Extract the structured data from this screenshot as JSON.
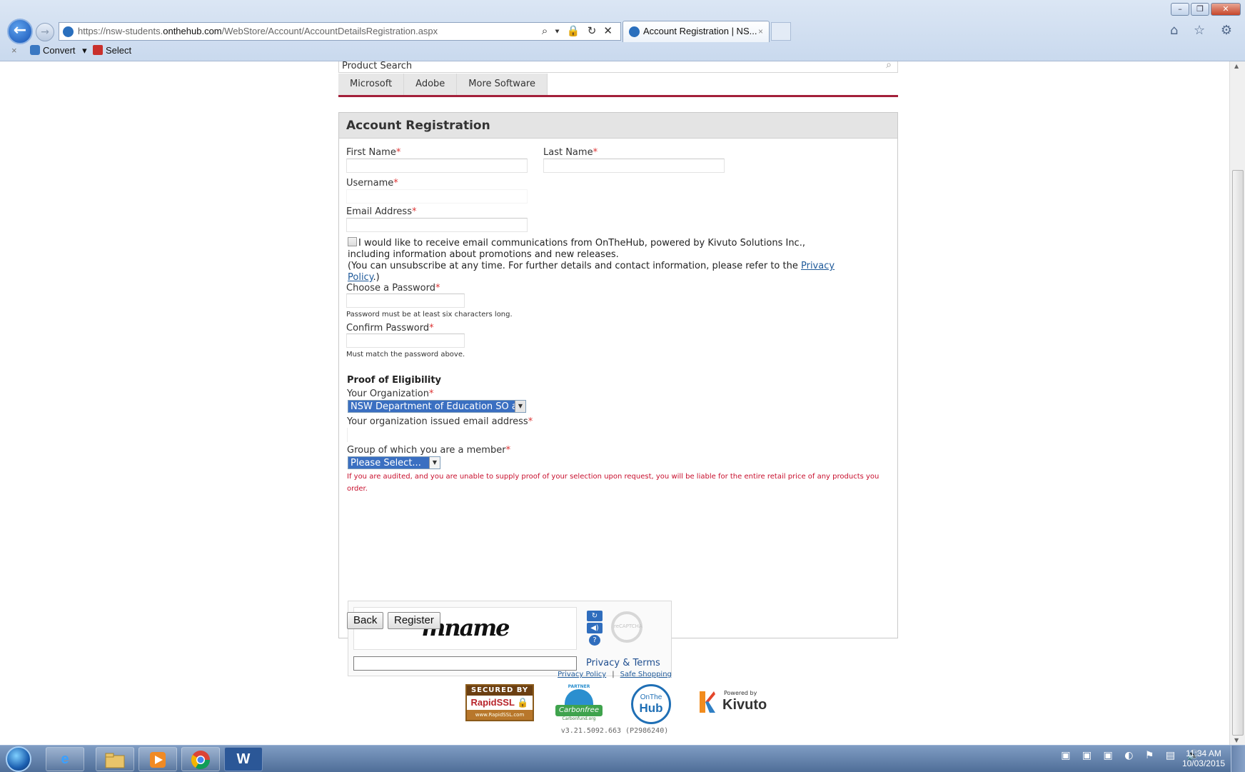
{
  "browser": {
    "url_prefix": "https://nsw-students.",
    "url_host": "onthehub.com",
    "url_path": "/WebStore/Account/AccountDetailsRegistration.aspx",
    "address_tools": "⌕ ▾ 🔒 ↻ ✕",
    "tab_title": "Account Registration | NS...",
    "tab_close": "×",
    "win_minimize": "–",
    "win_restore": "❐",
    "win_close": "✕",
    "right_icons": "⌂ ☆ ⚙",
    "cmd_close": "×",
    "cmd_convert": "Convert",
    "cmd_convert_arrow": "▾",
    "cmd_select": "Select"
  },
  "site": {
    "search_placeholder": "Product Search",
    "search_icon": "⌕",
    "menu": [
      "Microsoft",
      "Adobe",
      "More Software"
    ]
  },
  "form": {
    "title": "Account Registration",
    "required_marker": "*",
    "first_name_label": "First Name",
    "last_name_label": "Last Name",
    "username_label": "Username",
    "email_label": "Email Address",
    "consent_line1": "I would like to receive email communications from OnTheHub, powered by Kivuto Solutions Inc.,",
    "consent_line2": "including information about promotions and new releases.",
    "consent_line3_pre": "(You can unsubscribe at any time. For further details and contact information, please refer to the ",
    "consent_link_part1": "Privacy",
    "consent_link_part2": "Policy",
    "consent_line3_post": ".)",
    "password_label": "Choose a Password",
    "password_hint": "Password must be at least six characters long.",
    "confirm_label": "Confirm Password",
    "confirm_hint": "Must match the password above.",
    "eligibility_heading": "Proof of Eligibility",
    "organization_label": "Your Organization",
    "organization_value": "NSW Department of Education SO a",
    "org_email_label": "Your organization issued email address",
    "group_label": "Group of which you are a member",
    "group_value": "Please Select...",
    "audit_warning": "If you are audited, and you are unable to supply proof of your selection upon request, you will be liable for the entire retail price of any products you order.",
    "captcha_text": "mname",
    "captcha_logo": "reCAPTCHA",
    "captcha_refresh": "↻",
    "captcha_audio": "◀)",
    "captcha_help": "?",
    "captcha_terms": "Privacy & Terms",
    "back_button": "Back",
    "register_button": "Register"
  },
  "footer": {
    "privacy_link": "Privacy Policy",
    "separator": "|",
    "safe_link": "Safe Shopping",
    "ssl_top": "SECURED BY",
    "ssl_mid": "RapidSSL",
    "ssl_bottom": "www.RapidSSL.com",
    "carbon_top": "PARTNER",
    "carbon_text": "Carbonfree",
    "carbon_sub": "Carbonfund.org",
    "hub_on": "OnThe",
    "hub_hub": "Hub",
    "kivuto_powered": "Powered by",
    "kivuto_name": "Kivuto",
    "version": "v3.21.5092.663 (P2986240)"
  },
  "taskbar": {
    "word_label": "W",
    "tray_icons": "▣ ▣ ▣ ◐ ⚑ ▤ 🔊",
    "clock_time": "11:34 AM",
    "clock_date": "10/03/2015"
  },
  "colors": {
    "menu_rule": "#a3203a",
    "required": "#dd3333",
    "warning": "#c8102e",
    "select_highlight": "#3a6fc1"
  }
}
